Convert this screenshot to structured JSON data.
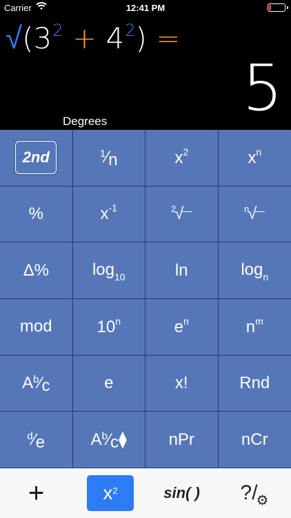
{
  "status": {
    "carrier": "Carrier",
    "time": "12:41 PM",
    "battery_color": "#ff3b30",
    "battery_level": 0.12
  },
  "display": {
    "expression": {
      "root": "√",
      "open": "(",
      "a": "3",
      "a_exp": "2",
      "op": "+",
      "b": "4",
      "b_exp": "2",
      "close": ")",
      "equals": "="
    },
    "result": "5",
    "angle_mode": "Degrees"
  },
  "keys": [
    {
      "name": "second-key",
      "label": "2nd"
    },
    {
      "name": "reciprocal-key",
      "num": "1",
      "slash": "⁄",
      "den": "n"
    },
    {
      "name": "square-key",
      "base": "x",
      "sup": "2"
    },
    {
      "name": "power-key",
      "base": "x",
      "sup": "n"
    },
    {
      "name": "percent-key",
      "label": "%"
    },
    {
      "name": "inverse-key",
      "base": "x",
      "sup": "-1"
    },
    {
      "name": "square-root-key",
      "idx": "2",
      "sym": "√"
    },
    {
      "name": "nth-root-key",
      "idx": "n",
      "sym": "√"
    },
    {
      "name": "percent-change-key",
      "label": "Δ%"
    },
    {
      "name": "log10-key",
      "base": "log",
      "sub": "10"
    },
    {
      "name": "ln-key",
      "label": "ln"
    },
    {
      "name": "logn-key",
      "base": "log",
      "sub": "n"
    },
    {
      "name": "mod-key",
      "label": "mod"
    },
    {
      "name": "ten-power-key",
      "base": "10",
      "sup": "n"
    },
    {
      "name": "e-power-key",
      "base": "e",
      "sup": "n"
    },
    {
      "name": "n-power-m-key",
      "base": "n",
      "sup": "m"
    },
    {
      "name": "fraction-key",
      "base": "A",
      "num": "b",
      "slash": "⁄",
      "den": "c"
    },
    {
      "name": "e-key",
      "label": "e"
    },
    {
      "name": "factorial-key",
      "label": "x!"
    },
    {
      "name": "random-key",
      "label": "Rnd"
    },
    {
      "name": "decimal-fraction-key",
      "num": "d",
      "slash": "⁄",
      "den": "e"
    },
    {
      "name": "fraction-toggle-key",
      "base": "A",
      "num": "b",
      "slash": "⁄",
      "den": "c",
      "suffix": "⧫"
    },
    {
      "name": "permutation-key",
      "label": "nPr"
    },
    {
      "name": "combination-key",
      "label": "nCr"
    }
  ],
  "toolbar": {
    "add_label": "+",
    "power_base": "x",
    "power_sup": "2",
    "trig_label": "sin( )",
    "help_label": "?/",
    "gear_icon": "gear-icon",
    "active_color": "#2d7cf6"
  }
}
